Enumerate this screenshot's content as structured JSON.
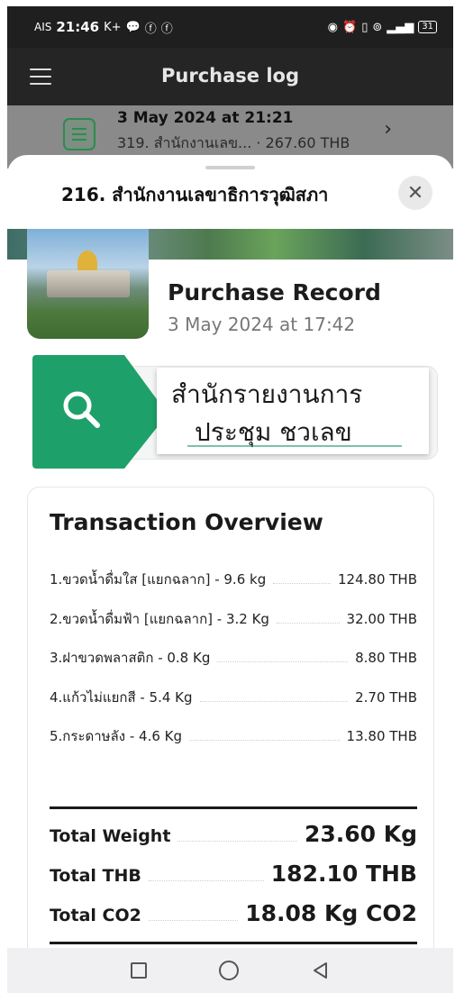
{
  "status_bar": {
    "carrier": "AIS",
    "time": "21:46",
    "left_extras": "K+",
    "right_icons": [
      "eye-icon",
      "alarm-icon",
      "vibrate-icon",
      "hotspot-icon",
      "volte-icon",
      "signal-icon",
      "battery-icon"
    ],
    "battery": "31"
  },
  "app_bar": {
    "title": "Purchase log",
    "menu_icon": "hamburger-icon"
  },
  "background_item": {
    "title": "3 May 2024 at 21:21",
    "subtitle": "319. สำนักงานเลข...  · 267.60 THB",
    "icon": "receipt-icon"
  },
  "sheet": {
    "title": "216. สำนักงานเลขาธิการวุฒิสภา",
    "close_icon": "close-icon",
    "record_title": "Purchase Record",
    "record_date": "3 May 2024 at 17:42",
    "promo": {
      "line1": "สำนักรายงานการ",
      "line2": "ประชุม ชวเลข"
    },
    "overview": {
      "title": "Transaction Overview",
      "items": [
        {
          "name": "1.ขวดน้ำดื่มใส [แยกฉลาก] - 9.6 kg",
          "price": "124.80 THB"
        },
        {
          "name": "2.ขวดน้ำดื่มฟ้า [แยกฉลาก] - 3.2 Kg",
          "price": "32.00 THB"
        },
        {
          "name": "3.ฝาขวดพลาสติก - 0.8 Kg",
          "price": "8.80 THB"
        },
        {
          "name": "4.แก้วไม่แยกสี - 5.4 Kg",
          "price": "2.70 THB"
        },
        {
          "name": "5.กระดาษลัง - 4.6 Kg",
          "price": "13.80 THB"
        }
      ],
      "totals": [
        {
          "label": "Total Weight",
          "value": "23.60 Kg"
        },
        {
          "label": "Total THB",
          "value": "182.10 THB"
        },
        {
          "label": "Total CO2",
          "value": "18.08 Kg CO2"
        }
      ]
    }
  },
  "nav_bar": {
    "buttons": [
      "recents-icon",
      "home-icon",
      "back-icon"
    ]
  },
  "colors": {
    "accent_green": "#1ea06a",
    "appbar_bg": "#252525"
  }
}
